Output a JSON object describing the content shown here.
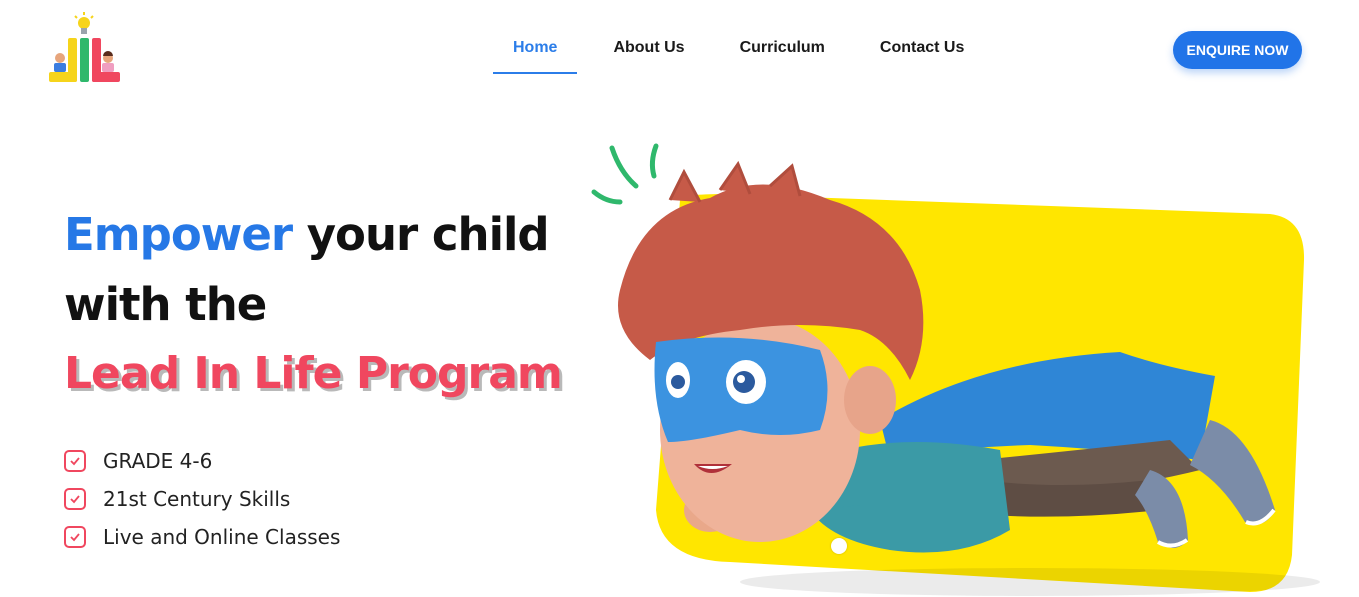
{
  "nav": {
    "items": [
      {
        "label": "Home",
        "active": true
      },
      {
        "label": "About Us",
        "active": false
      },
      {
        "label": "Curriculum",
        "active": false
      },
      {
        "label": "Contact Us",
        "active": false
      }
    ],
    "cta_label": "ENQUIRE NOW"
  },
  "hero": {
    "highlight": "Empower",
    "line1_rest": " your child",
    "line2": "with the",
    "program": "Lead In Life Program",
    "bullets": [
      "GRADE 4-6",
      "21st Century Skills",
      "Live and Online Classes"
    ]
  },
  "colors": {
    "brand_blue": "#2174e8",
    "accent_red": "#f0475f",
    "hero_yellow": "#ffe600"
  },
  "icons": {
    "logo": "lil-logo-icon",
    "check": "check-box-icon",
    "mascot": "superhero-boy-illustration"
  }
}
